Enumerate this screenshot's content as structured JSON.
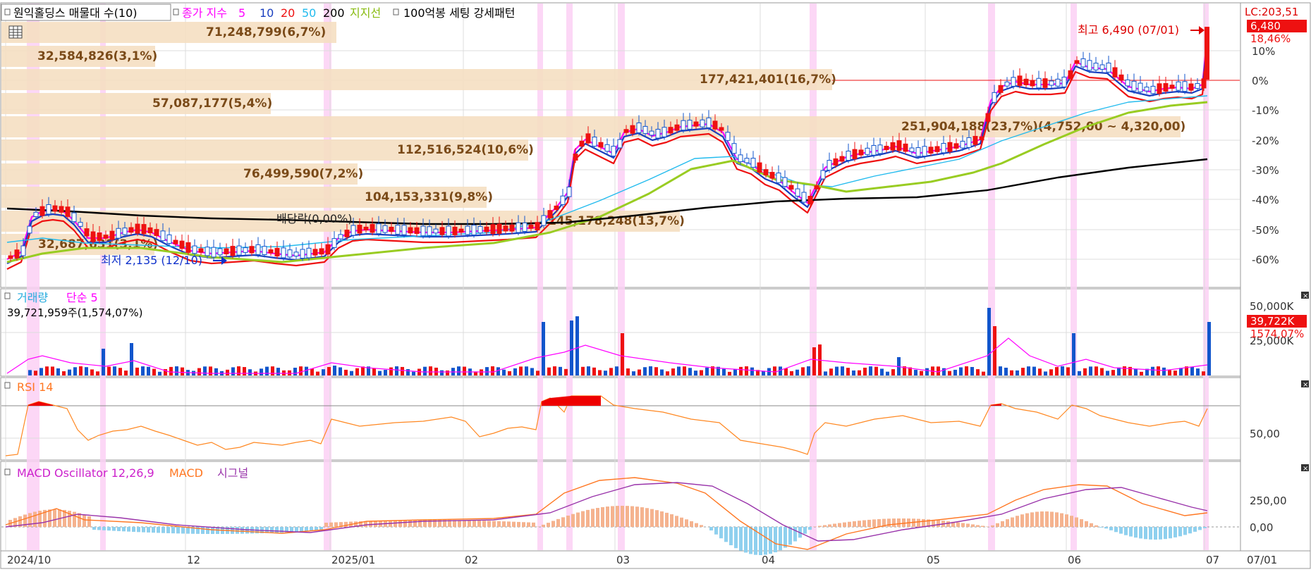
{
  "legend": {
    "title": "원익홀딩스 매물대 수(10)",
    "ma_label": "종가 지수",
    "ma_periods": [
      "5",
      "10",
      "20",
      "50",
      "200"
    ],
    "support": "지지선",
    "pattern": "100억봉 세팅 강세패턴"
  },
  "price_axis": {
    "lc_label": "LC:203,51",
    "current_price": "6,480",
    "current_pct": "18,46%",
    "ticks": [
      "10%",
      "0%",
      "-10%",
      "-20%",
      "-30%",
      "-40%",
      "-50%",
      "-60%"
    ]
  },
  "price_annotations": {
    "high": "최고 6,490 (07/01)",
    "low": "최저 2,135 (12/10)",
    "dividend": "배당락(0,00%)"
  },
  "volume_profile": [
    "71,248,799(6,7%)",
    "32,584,826(3,1%)",
    "177,421,401(16,7%)",
    "57,087,177(5,4%)",
    "251,904,188(23,7%)(4,752,00 ~ 4,320,00)",
    "112,516,524(10,6%)",
    "76,499,590(7,2%)",
    "104,153,331(9,8%)",
    "145,178,248(13,7%)",
    "32,687,631(3,1%)"
  ],
  "volume_panel": {
    "title": "거래량",
    "ma": "단순 5",
    "info": "39,721,959주(1,574,07%)",
    "axis_ticks": [
      "50,000K",
      "25,000K"
    ],
    "current": "39,722K",
    "current_pct": "1574,07%"
  },
  "rsi_panel": {
    "title": "RSI 14",
    "axis_tick": "50,00"
  },
  "macd_panel": {
    "title": "MACD Oscillator 12,26,9",
    "macd": "MACD",
    "signal": "시그널",
    "axis_ticks": [
      "250,00",
      "0,00"
    ]
  },
  "x_axis": {
    "labels": [
      "2024/10",
      "12",
      "2025/01",
      "02",
      "03",
      "04",
      "05",
      "06",
      "07"
    ],
    "current_date": "07/01"
  },
  "colors": {
    "ma5": "#ff00ff",
    "ma10": "#1a3fbf",
    "ma20": "#ee1111",
    "ma50": "#22bbee",
    "ma200": "#000000",
    "support": "#99cc22",
    "up": "#ee1111",
    "down": "#1155cc",
    "rsi": "#ff8822",
    "macd": "#ff7722",
    "signal": "#9933aa",
    "profile": "#f5dfc2",
    "highlight": "#fbd0f5"
  },
  "chart_data": {
    "type": "candlestick",
    "period": "2024/10 ~ 2025/07/01",
    "price": {
      "unit": "KRW",
      "high": 6490,
      "high_date": "07/01",
      "low": 2135,
      "low_date": "12/10",
      "last": 6480,
      "last_change_pct": 18.46,
      "pct_axis_range": [
        -65,
        15
      ]
    },
    "volume_last": 39721959,
    "volume_change_pct": 1574.07,
    "rsi_period": 14,
    "macd_params": [
      12,
      26,
      9
    ]
  }
}
